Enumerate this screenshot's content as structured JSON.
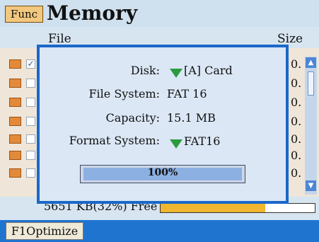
{
  "titlebar": {
    "func_label": "Func",
    "title": "Memory"
  },
  "columns": {
    "file": "File",
    "size": "Size"
  },
  "rows": [
    {
      "checked": true,
      "size": "0."
    },
    {
      "checked": false,
      "size": "0."
    },
    {
      "checked": false,
      "size": "0."
    },
    {
      "checked": false,
      "size": "0."
    },
    {
      "checked": false,
      "size": "0."
    },
    {
      "checked": false,
      "size": "0."
    },
    {
      "checked": false,
      "size": "0."
    }
  ],
  "status": {
    "free_text": "5651 KB(32%) Free",
    "used_fraction": 0.68
  },
  "footer": {
    "f1_label": "F1Optimize"
  },
  "dialog": {
    "disk_label": "Disk:",
    "disk_value": "[A] Card",
    "fs_label": "File System:",
    "fs_value": "FAT 16",
    "capacity_label": "Capacity:",
    "capacity_value": "15.1 MB",
    "format_label": "Format System:",
    "format_value": "FAT16",
    "progress_text": "100%",
    "progress_fraction": 1.0
  },
  "colors": {
    "accent": "#1a68c9",
    "footer": "#1f74d0",
    "dropdown_arrow": "#2e9a3f",
    "free_fill": "#f0b62f"
  },
  "icons": {
    "row_file": "file-icon",
    "dropdown": "triangle-down-icon",
    "scroll_up": "arrow-up-icon",
    "scroll_down": "arrow-down-icon"
  }
}
